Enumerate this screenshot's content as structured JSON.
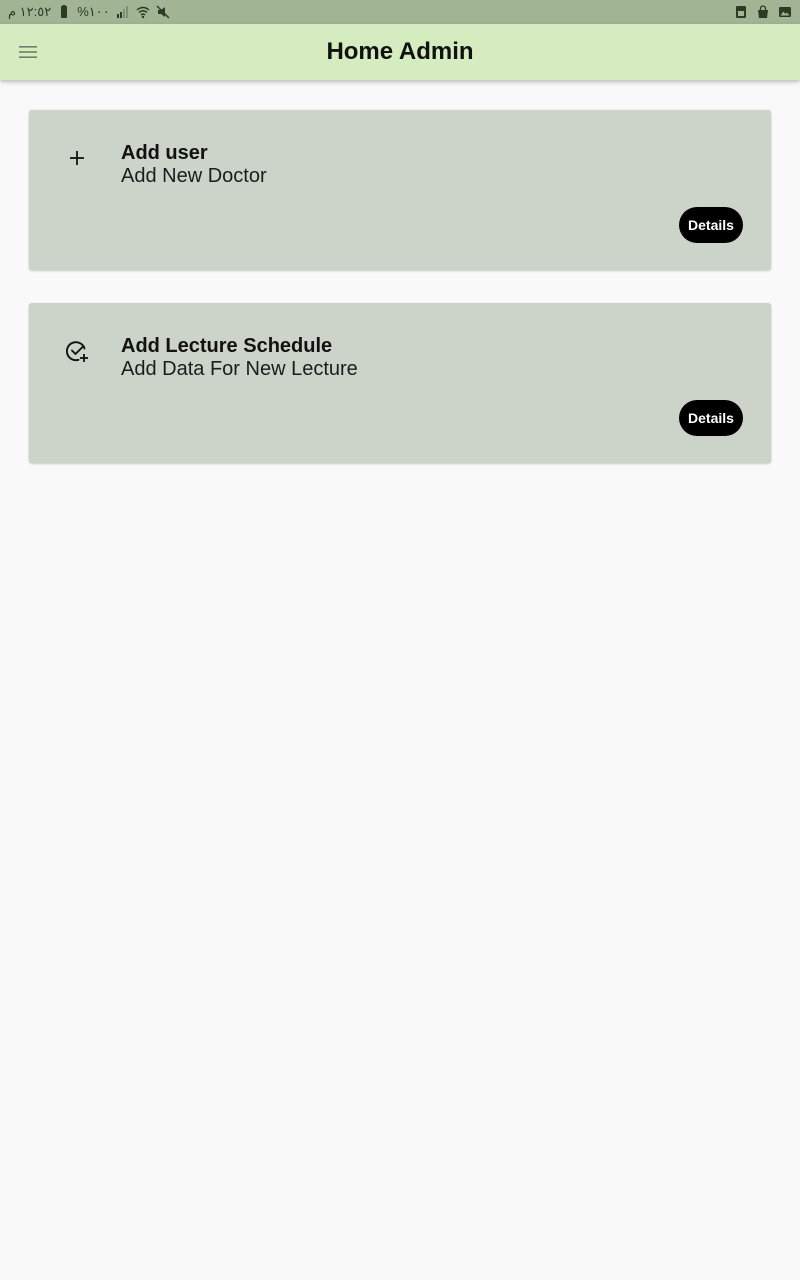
{
  "status_bar": {
    "time": "١٢:٥٢ م",
    "battery": "%١٠٠",
    "icons_left": [
      "battery-icon",
      "signal-icon",
      "wifi-icon",
      "mute-icon"
    ],
    "icons_right": [
      "sim-icon",
      "bag-icon",
      "image-icon"
    ]
  },
  "app_bar": {
    "title": "Home Admin",
    "menu_icon": "hamburger-menu-icon",
    "background": "#d4ecc0"
  },
  "cards": [
    {
      "icon": "plus-icon",
      "title": "Add user",
      "subtitle": "Add New Doctor",
      "button_label": "Details"
    },
    {
      "icon": "check-circle-add-icon",
      "title": "Add Lecture Schedule",
      "subtitle": "Add Data For New Lecture",
      "button_label": "Details"
    }
  ],
  "colors": {
    "status_bar": "#a1b594",
    "card_background": "#ccd3c8",
    "page_background": "#f9f9f9",
    "button_background": "#000000"
  }
}
